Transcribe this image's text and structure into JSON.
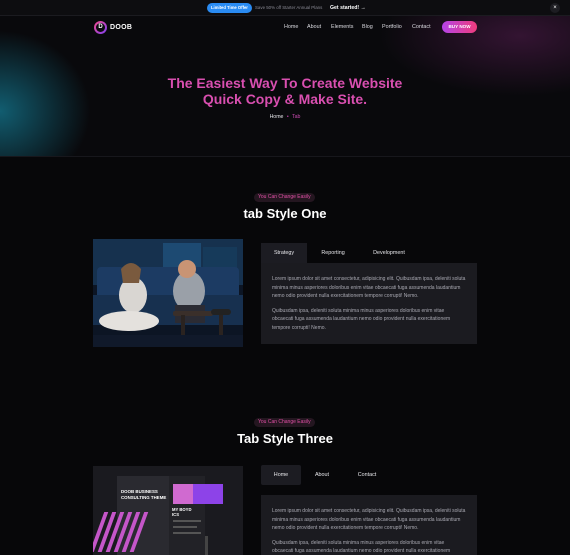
{
  "promo": {
    "badge": "Limited Time Offer",
    "text": "Save 50% off Starter Annual Plans",
    "link": "Get started! →",
    "close": "×"
  },
  "header": {
    "logo_letter": "D",
    "logo_text": "DOOB",
    "nav": [
      "Home",
      "About",
      "Elements",
      "Blog",
      "Portfolio",
      "Contact"
    ],
    "buy_label": "BUY NOW"
  },
  "hero": {
    "title_line1": "The Easiest Way To Create Website",
    "title_line2": "Quick Copy & Make Site.",
    "breadcrumb": {
      "home": "Home",
      "separator": "•",
      "current": "Tab"
    }
  },
  "section_one": {
    "pill": "You Can Change Easily",
    "title": "tab Style One",
    "tabs": [
      "Strategy",
      "Reporting",
      "Development"
    ],
    "active_tab": "Strategy",
    "paragraphs": [
      "Lorem ipsum dolor sit amet consectetur, adipisicing elit. Quibusdam ipsa, deleniti soluta minima minus asperiores doloribus enim vitae obcaecati fuga assumenda laudantium nemo odio provident nulla exercitationem tempore corrupti! Nemo.",
      "Quibusdam ipsa, deleniti soluta minima minus asperiores doloribus enim vitae obcaecati fuga assumenda laudantium nemo odio provident nulla exercitationem tempore corrupti! Nemo."
    ]
  },
  "section_three": {
    "pill": "You Can Change Easily",
    "title": "Tab Style Three",
    "tabs": [
      "Home",
      "About",
      "Contact"
    ],
    "active_tab": "Home",
    "paragraphs": [
      "Lorem ipsum dolor sit amet consectetur, adipisicing elit. Quibusdam ipsa, deleniti soluta minima minus asperiores doloribus enim vitae obcaecati fuga assumenda laudantium nemo odio provident nulla exercitationem tempore corrupti! Nemo.",
      "Quibusdam ipsa, deleniti soluta minima minus asperiores doloribus enim vitae obcaecati fuga assumenda laudantium nemo odio provident nulla exercitationem tempore corrupti! Nemo."
    ],
    "mockup": {
      "line1": "DOOB BUSINESS",
      "line2": "CONSULTING THEME",
      "line3": "MY BOYD",
      "line4": "ICS"
    }
  },
  "colors": {
    "accent_pink": "#d94fb0",
    "accent_purple": "#b544e8",
    "background": "#070709",
    "panel": "#1b1b20",
    "promo_blue": "#2a8bf2"
  }
}
